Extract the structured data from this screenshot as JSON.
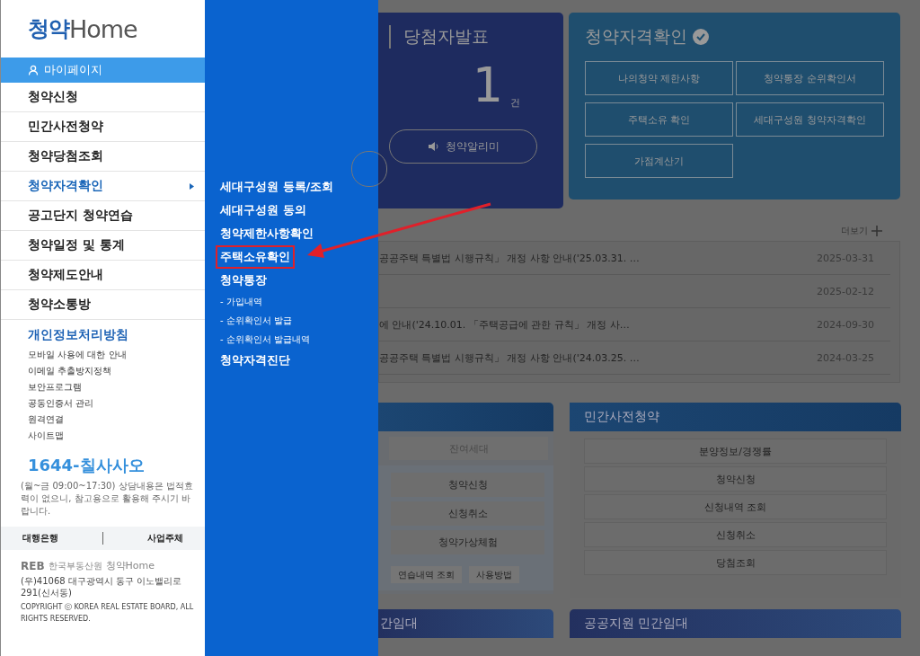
{
  "sidebar": {
    "logo": {
      "brand": "청약",
      "home": "Home"
    },
    "mypage": "마이페이지",
    "menu": [
      {
        "label": "청약신청",
        "selected": false
      },
      {
        "label": "민간사전청약",
        "selected": false
      },
      {
        "label": "청약당첨조회",
        "selected": false
      },
      {
        "label": "청약자격확인",
        "selected": true
      },
      {
        "label": "공고단지 청약연습",
        "selected": false
      },
      {
        "label": "청약일정 및 통계",
        "selected": false
      },
      {
        "label": "청약제도안내",
        "selected": false
      },
      {
        "label": "청약소통방",
        "selected": false
      }
    ],
    "privacy": "개인정보처리방침",
    "links": [
      "모바일 사용에 대한 안내",
      "이메일 추출방지정책",
      "보안프로그램",
      "공동인증서 관리",
      "원격연결",
      "사이트맵"
    ],
    "phone": "1644-칠사사오",
    "phone_note": "(월~금 09:00~17:30) 상담내용은 법적효력이 없으니, 참고용으로 활용해 주시기 바랍니다.",
    "bottom_tabs": [
      "대행은행",
      "사업주체"
    ],
    "footer": {
      "reb": "REB",
      "org": "한국부동산원",
      "brand": "청약",
      "home": "Home",
      "address": "(우)41068 대구광역시 동구 이노밸리로 291(신서동)",
      "copyright": "COPYRIGHT ⓒ KOREA REAL ESTATE BOARD, ALL RIGHTS RESERVED."
    }
  },
  "flyout": [
    {
      "kind": "main",
      "label": "세대구성원 등록/조회",
      "highlighted": false
    },
    {
      "kind": "main",
      "label": "세대구성원 동의",
      "highlighted": false
    },
    {
      "kind": "main",
      "label": "청약제한사항확인",
      "highlighted": false
    },
    {
      "kind": "main",
      "label": "주택소유확인",
      "highlighted": true
    },
    {
      "kind": "main",
      "label": "청약통장",
      "highlighted": false
    },
    {
      "kind": "sub",
      "label": "- 가입내역",
      "highlighted": false
    },
    {
      "kind": "sub",
      "label": "- 순위확인서 발급",
      "highlighted": false
    },
    {
      "kind": "sub",
      "label": "- 순위확인서 발급내역",
      "highlighted": false
    },
    {
      "kind": "main",
      "label": "청약자격진단",
      "highlighted": false
    }
  ],
  "winner_card": {
    "title": "당첨자발표",
    "count": "1",
    "unit": "건",
    "button": "청약알리미"
  },
  "eligibility_card": {
    "title": "청약자격확인",
    "buttons": [
      "나의청약 제한사항",
      "청약통장 순위확인서",
      "주택소유 확인",
      "세대구성원 청약자격확인",
      "가점계산기"
    ]
  },
  "notices": {
    "more": "더보기",
    "rows": [
      {
        "title": "공공주택 특별법 시행규칙」 개정 사항 안내('25.03.31. …",
        "date": "2025-03-31"
      },
      {
        "title": "",
        "date": "2025-02-12"
      },
      {
        "title": "에 안내('24.10.01. 「주택공급에 관한 규칙」 개정 사…",
        "date": "2024-09-30"
      },
      {
        "title": "공공주택 특별법 시행규칙」 개정 사항 안내('24.03.25. …",
        "date": "2024-03-25"
      }
    ]
  },
  "practice_card": {
    "tab": "잔여세대",
    "buttons": [
      "청약신청",
      "신청취소",
      "청약가상체험"
    ],
    "small_buttons": [
      "연습내역 조회",
      "사용방법"
    ]
  },
  "presale_card": {
    "title": "민간사전청약",
    "items": [
      "분양정보/경쟁률",
      "청약신청",
      "신청내역 조회",
      "신청취소",
      "당첨조회"
    ]
  },
  "bottom_cards": [
    "간임대",
    "공공지원 민간임대"
  ]
}
